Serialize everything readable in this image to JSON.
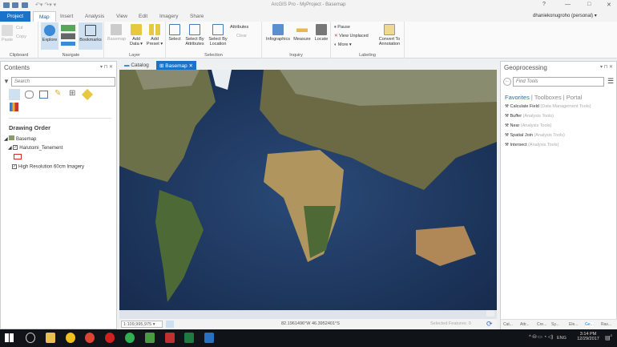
{
  "window": {
    "title": "ArcGIS Pro - MyProject - Basemap",
    "help": "?",
    "minimize": "—",
    "restore": "□",
    "close": "✕"
  },
  "user": {
    "name": "dhaniekonugroho (personal) ▾"
  },
  "tabs": [
    {
      "label": "Project"
    },
    {
      "label": "Map"
    },
    {
      "label": "Insert"
    },
    {
      "label": "Analysis"
    },
    {
      "label": "View"
    },
    {
      "label": "Edit"
    },
    {
      "label": "Imagery"
    },
    {
      "label": "Share"
    }
  ],
  "ribbon": {
    "clipboard": {
      "label": "Clipboard",
      "paste": "Paste",
      "cut": "Cut",
      "copy": "Copy"
    },
    "navigate": {
      "label": "Navigate",
      "explore": "Explore",
      "bookmarks": "Bookmarks"
    },
    "layer": {
      "label": "Layer",
      "basemap": "Basemap",
      "add_data": "Add Data ▾",
      "add_preset": "Add Preset ▾"
    },
    "selection": {
      "label": "Selection",
      "select": "Select",
      "by_attributes": "Select By Attributes",
      "by_location": "Select By Location",
      "attributes": "Attributes",
      "clear": "Clear"
    },
    "inquiry": {
      "label": "Inquiry",
      "infographics": "Infographics",
      "measure": "Measure",
      "locate": "Locate"
    },
    "labeling": {
      "label": "Labeling",
      "pause": "Pause",
      "view_unplaced": "View Unplaced",
      "more": "More ▾",
      "convert": "Convert To Annotation"
    }
  },
  "contents": {
    "title": "Contents",
    "search_placeholder": "Search",
    "section": "Drawing Order",
    "layers": [
      {
        "name": "Basemap"
      },
      {
        "name": "Harutomi_Tenement",
        "checked": true
      },
      {
        "name": "High Resolution 60cm Imagery",
        "checked": true
      }
    ]
  },
  "map_tabs": [
    {
      "label": "Catalog"
    },
    {
      "label": "Basemap",
      "active": true
    }
  ],
  "status": {
    "scale": "1:109,995,975",
    "coords": "82.1961496°W 46.3952401°S",
    "selected": "Selected Features: 0"
  },
  "geoprocessing": {
    "title": "Geoprocessing",
    "search_placeholder": "Find Tools",
    "nav": [
      {
        "label": "Favorites",
        "active": true
      },
      {
        "label": "Toolboxes"
      },
      {
        "label": "Portal"
      }
    ],
    "tools": [
      {
        "name": "Calculate Field",
        "box": "(Data Management Tools)"
      },
      {
        "name": "Buffer",
        "box": "(Analysis Tools)"
      },
      {
        "name": "Near",
        "box": "(Analysis Tools)"
      },
      {
        "name": "Spatial Join",
        "box": "(Analysis Tools)"
      },
      {
        "name": "Intersect",
        "box": "(Analysis Tools)"
      }
    ],
    "bottom_tabs": [
      "Cat...",
      "Attr...",
      "Cre...",
      "Sy...",
      "Ele...",
      "Ge...",
      "Ras..."
    ]
  },
  "taskbar": {
    "lang": "ENG",
    "time": "3:14 PM",
    "date": "12/29/2017",
    "notif": "2"
  },
  "colors": {
    "accent": "#1a73c8",
    "ocean": "#1c3358",
    "taskbar": "#101418"
  }
}
